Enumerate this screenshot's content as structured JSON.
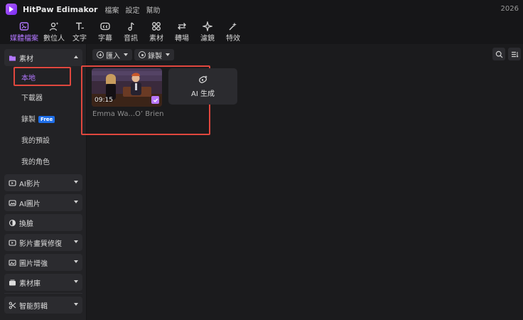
{
  "titlebar": {
    "app_name": "HitPaw Edimakor",
    "menu": [
      "檔案",
      "設定",
      "幫助"
    ],
    "year": "2026"
  },
  "toolbar": {
    "items": [
      {
        "label": "媒體檔案",
        "icon": "media-files-icon",
        "active": true
      },
      {
        "label": "數位人",
        "icon": "digital-human-icon",
        "active": false
      },
      {
        "label": "文字",
        "icon": "text-icon",
        "active": false
      },
      {
        "label": "字幕",
        "icon": "subtitle-icon",
        "active": false
      },
      {
        "label": "音訊",
        "icon": "audio-icon",
        "active": false
      },
      {
        "label": "素材",
        "icon": "materials-icon",
        "active": false
      },
      {
        "label": "轉場",
        "icon": "transition-icon",
        "active": false
      },
      {
        "label": "濾鏡",
        "icon": "filter-icon",
        "active": false
      },
      {
        "label": "特效",
        "icon": "effects-icon",
        "active": false
      }
    ]
  },
  "sidebar": {
    "material_section": "素材",
    "sub_items": {
      "local": "本地",
      "downloader": "下載器",
      "record": "錄製",
      "free_badge": "Free",
      "presets": "我的預設",
      "characters": "我的角色"
    },
    "sections": {
      "ai_video": "AI影片",
      "ai_image": "AI圖片",
      "face_swap": "換臉",
      "video_enhance": "影片畫質修復",
      "image_enhance": "圖片增強",
      "library": "素材庫",
      "smart_cut": "智能剪輯"
    }
  },
  "content": {
    "import_label": "匯入",
    "record_label": "錄製",
    "clip": {
      "duration": "09:15",
      "name": "Emma Wa...O’ Brien",
      "selected": true
    },
    "ai_card_label": "AI 生成"
  },
  "colors": {
    "accent": "#b277ff",
    "highlight_box": "#e0473e",
    "free_badge": "#1e6ee8"
  }
}
